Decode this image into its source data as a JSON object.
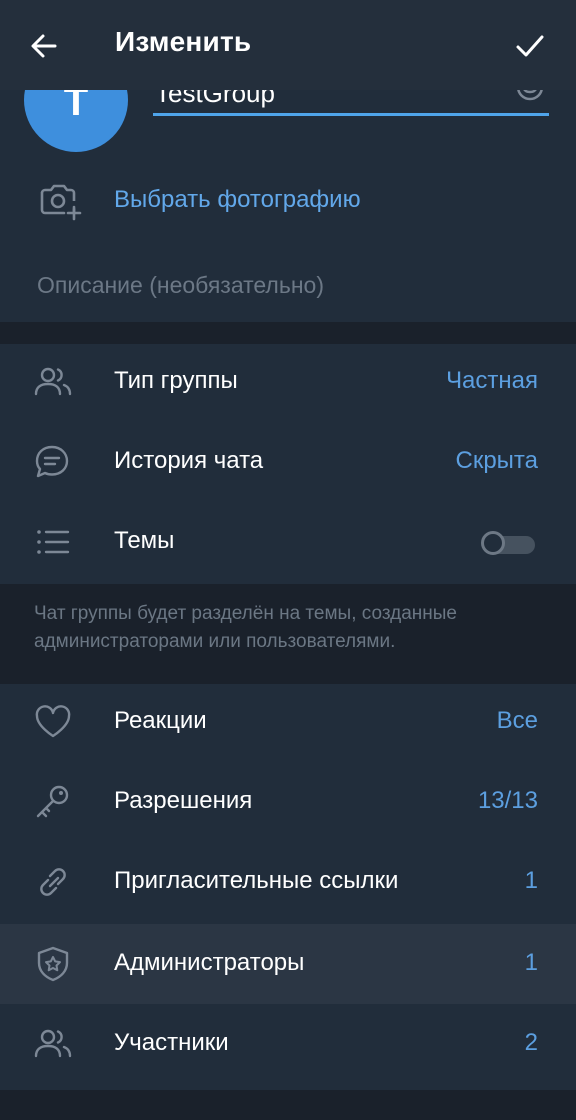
{
  "app_bar": {
    "title": "Изменить",
    "back_icon": "arrow-left-icon",
    "done_icon": "checkmark-icon"
  },
  "profile": {
    "avatar_letter": "T",
    "avatar_color": "#3e8fdd",
    "name_value": "TestGroup",
    "emoji_icon": "smile-icon",
    "choose_photo_label": "Выбрать фотографию",
    "description_placeholder": "Описание (необязательно)"
  },
  "settings": {
    "group_type": {
      "label": "Тип группы",
      "value": "Частная",
      "icon": "users-icon"
    },
    "chat_history": {
      "label": "История чата",
      "value": "Скрыта",
      "icon": "chat-bubble-icon"
    },
    "topics": {
      "label": "Темы",
      "enabled": false,
      "icon": "list-icon"
    },
    "topics_hint": "Чат группы будет разделён на темы, созданные администраторами или пользователями."
  },
  "management": {
    "reactions": {
      "label": "Реакции",
      "value": "Все",
      "icon": "heart-icon"
    },
    "permissions": {
      "label": "Разрешения",
      "value": "13/13",
      "icon": "key-icon"
    },
    "invite_links": {
      "label": "Пригласительные ссылки",
      "value": "1",
      "icon": "link-icon"
    },
    "admins": {
      "label": "Администраторы",
      "value": "1",
      "icon": "shield-star-icon"
    },
    "members": {
      "label": "Участники",
      "value": "2",
      "icon": "users-icon"
    }
  },
  "colors": {
    "accent": "#5c9fe0",
    "background": "#212d3b",
    "separator": "#1a212b",
    "highlight_row": "#2b3644"
  }
}
